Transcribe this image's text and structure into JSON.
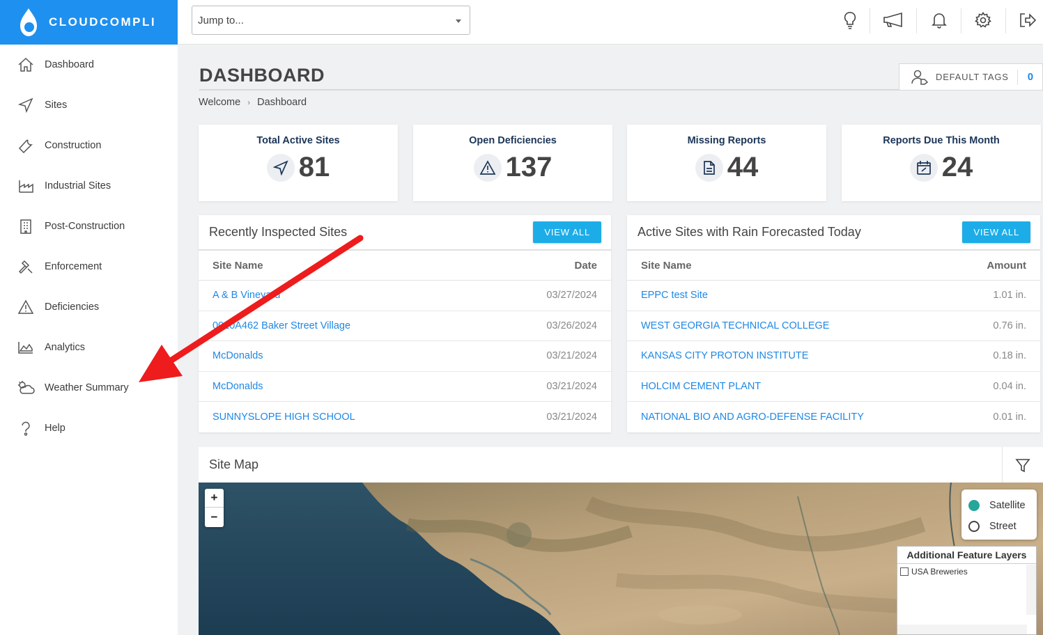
{
  "brand": {
    "name": "CLOUDCOMPLI",
    "color": "#1e90ef"
  },
  "sidebar": {
    "items": [
      {
        "label": "Dashboard",
        "icon": "home-icon"
      },
      {
        "label": "Sites",
        "icon": "navigation-icon"
      },
      {
        "label": "Construction",
        "icon": "wrench-icon"
      },
      {
        "label": "Industrial Sites",
        "icon": "factory-icon"
      },
      {
        "label": "Post-Construction",
        "icon": "building-icon"
      },
      {
        "label": "Enforcement",
        "icon": "gavel-icon"
      },
      {
        "label": "Deficiencies",
        "icon": "warning-icon"
      },
      {
        "label": "Analytics",
        "icon": "area-chart-icon"
      },
      {
        "label": "Weather Summary",
        "icon": "cloud-sun-icon"
      },
      {
        "label": "Help",
        "icon": "help-icon"
      }
    ]
  },
  "topbar": {
    "jump_placeholder": "Jump to...",
    "icons": [
      "lightbulb-icon",
      "megaphone-icon",
      "bell-icon",
      "gear-icon",
      "logout-icon"
    ]
  },
  "header": {
    "title": "DASHBOARD",
    "default_tags_label": "DEFAULT TAGS",
    "default_tags_count": "0",
    "breadcrumb": [
      "Welcome",
      "Dashboard"
    ]
  },
  "stats": [
    {
      "title": "Total Active Sites",
      "value": "81",
      "icon": "navigation-icon"
    },
    {
      "title": "Open Deficiencies",
      "value": "137",
      "icon": "warning-icon"
    },
    {
      "title": "Missing Reports",
      "value": "44",
      "icon": "document-icon"
    },
    {
      "title": "Reports Due This Month",
      "value": "24",
      "icon": "calendar-icon"
    }
  ],
  "recent": {
    "title": "Recently Inspected Sites",
    "view_all": "VIEW ALL",
    "columns": [
      "Site Name",
      "Date"
    ],
    "rows": [
      {
        "name": "A & B Vineyard",
        "value": "03/27/2024"
      },
      {
        "name": "0010A462 Baker Street Village",
        "value": "03/26/2024"
      },
      {
        "name": "McDonalds",
        "value": "03/21/2024"
      },
      {
        "name": "McDonalds",
        "value": "03/21/2024"
      },
      {
        "name": "SUNNYSLOPE HIGH SCHOOL",
        "value": "03/21/2024"
      }
    ]
  },
  "rain": {
    "title": "Active Sites with Rain Forecasted Today",
    "view_all": "VIEW ALL",
    "columns": [
      "Site Name",
      "Amount"
    ],
    "rows": [
      {
        "name": "EPPC test Site",
        "value": "1.01 in."
      },
      {
        "name": "WEST GEORGIA TECHNICAL COLLEGE",
        "value": "0.76 in."
      },
      {
        "name": "KANSAS CITY PROTON INSTITUTE",
        "value": "0.18 in."
      },
      {
        "name": "HOLCIM CEMENT PLANT",
        "value": "0.04 in."
      },
      {
        "name": "NATIONAL BIO AND AGRO-DEFENSE FACILITY",
        "value": "0.01 in."
      }
    ]
  },
  "map": {
    "title": "Site Map",
    "zoom_in": "+",
    "zoom_out": "−",
    "layers": [
      "Satellite",
      "Street"
    ],
    "selected_layer": "Satellite",
    "feature_title": "Additional Feature Layers",
    "features": [
      "USA Breweries"
    ]
  },
  "colors": {
    "accent": "#1cade8",
    "link": "#1e88e5",
    "annotation_arrow": "#ee1c1c",
    "stat_title": "#1b3557"
  }
}
